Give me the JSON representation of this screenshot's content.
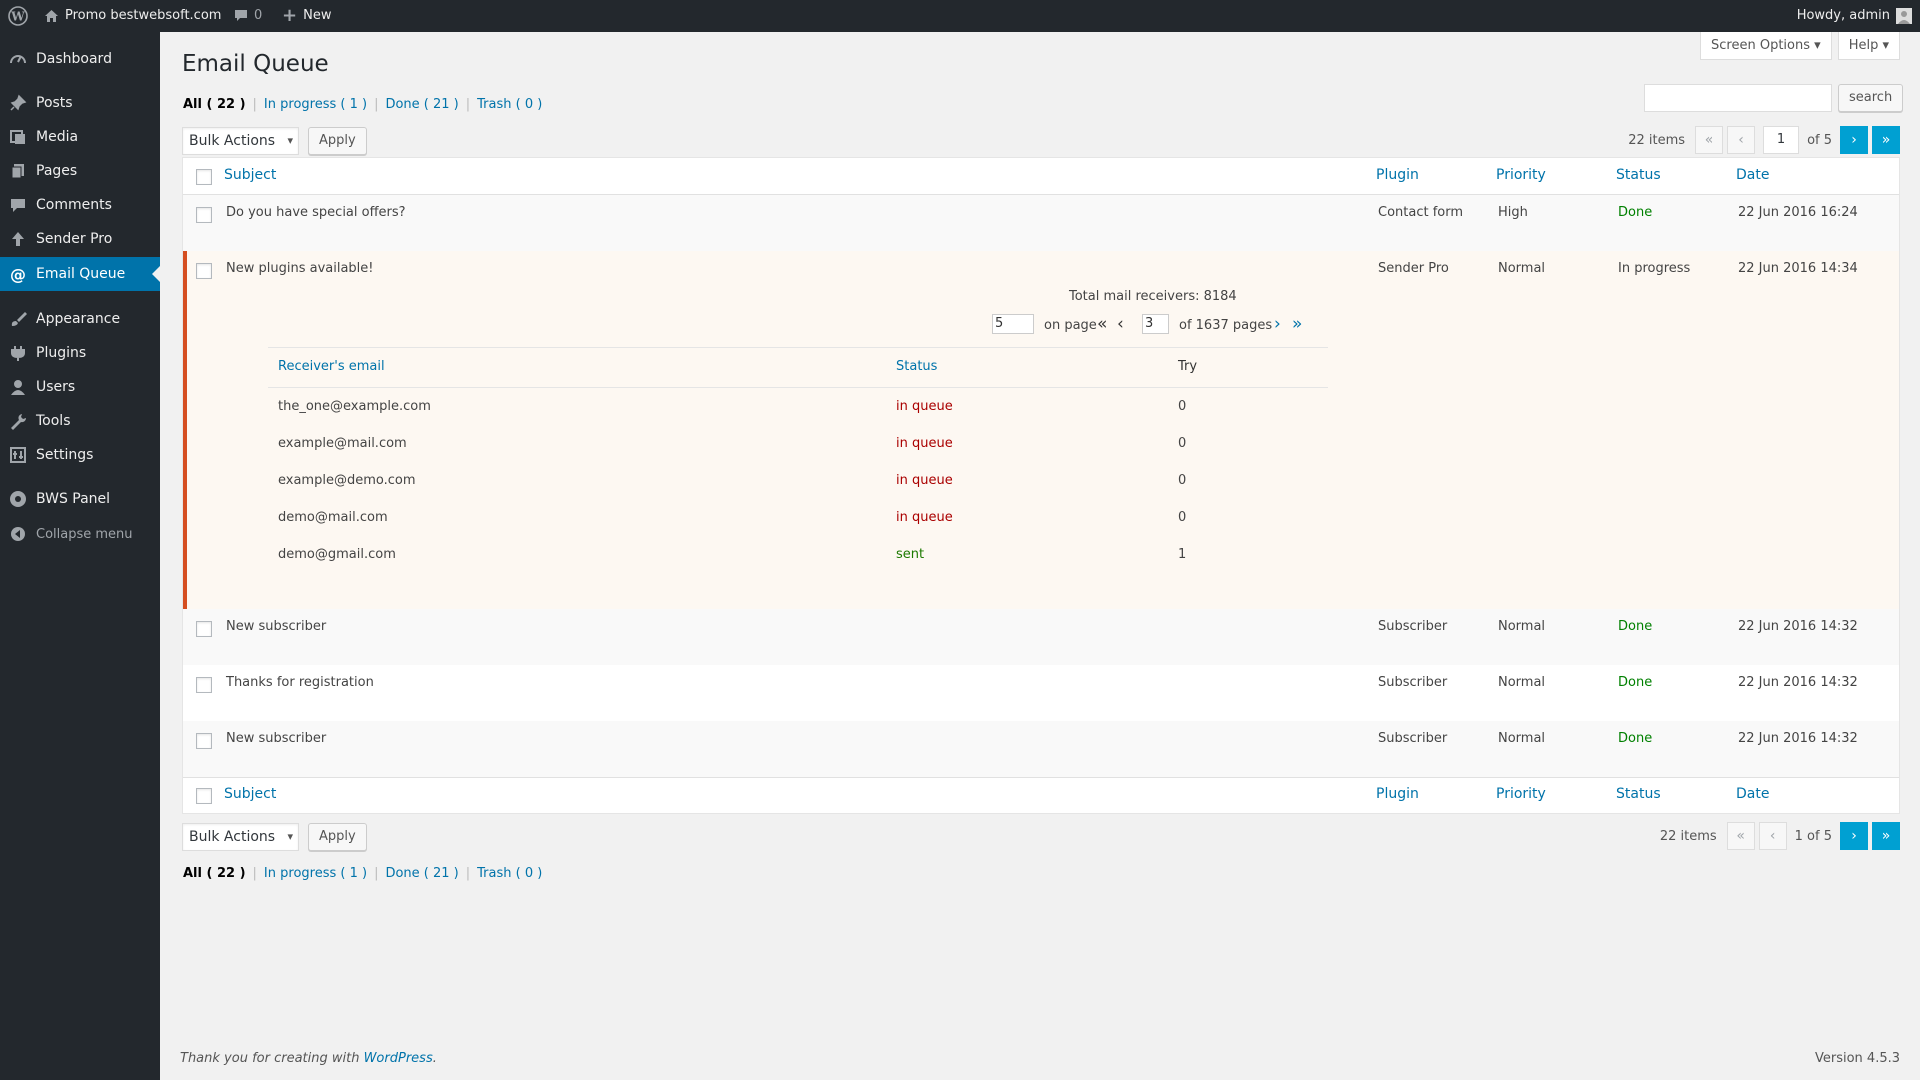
{
  "admin_bar": {
    "site_name": "Promo bestwebsoft.com",
    "comments_count": "0",
    "new_label": "New",
    "howdy": "Howdy, admin"
  },
  "sidebar": {
    "items": [
      {
        "label": "Dashboard",
        "icon": "dashboard-icon"
      },
      {
        "label": "Posts",
        "icon": "pin-icon"
      },
      {
        "label": "Media",
        "icon": "media-icon"
      },
      {
        "label": "Pages",
        "icon": "pages-icon"
      },
      {
        "label": "Comments",
        "icon": "comment-icon"
      },
      {
        "label": "Sender Pro",
        "icon": "upload-icon"
      },
      {
        "label": "Email Queue",
        "icon": "at-icon"
      },
      {
        "label": "Appearance",
        "icon": "brush-icon"
      },
      {
        "label": "Plugins",
        "icon": "plugin-icon"
      },
      {
        "label": "Users",
        "icon": "user-icon"
      },
      {
        "label": "Tools",
        "icon": "wrench-icon"
      },
      {
        "label": "Settings",
        "icon": "settings-icon"
      },
      {
        "label": "BWS Panel",
        "icon": "bws-icon"
      },
      {
        "label": "Collapse menu",
        "icon": "collapse-icon"
      }
    ]
  },
  "header": {
    "screen_options": "Screen Options",
    "help": "Help",
    "title": "Email Queue",
    "search_button": "search"
  },
  "filters": {
    "all": "All ( 22 )",
    "in_progress": "In progress ( 1 )",
    "done": "Done ( 21 )",
    "trash": "Trash ( 0 )"
  },
  "bulk": {
    "select_value": "Bulk Actions",
    "apply": "Apply"
  },
  "pagination_top": {
    "items": "22 items",
    "current_page": "1",
    "of": "of 5"
  },
  "pagination_bottom": {
    "items": "22 items",
    "status": "1 of 5"
  },
  "columns": {
    "subject": "Subject",
    "plugin": "Plugin",
    "priority": "Priority",
    "status": "Status",
    "date": "Date"
  },
  "rows": [
    {
      "subject": "Do you have special offers?",
      "plugin": "Contact form",
      "priority": "High",
      "status": "Done",
      "date": "22 Jun 2016 16:24"
    },
    {
      "subject": "New plugins available!",
      "plugin": "Sender Pro",
      "priority": "Normal",
      "status": "In progress",
      "date": "22 Jun 2016 14:34"
    },
    {
      "subject": "New subscriber",
      "plugin": "Subscriber",
      "priority": "Normal",
      "status": "Done",
      "date": "22 Jun 2016 14:32"
    },
    {
      "subject": "Thanks for registration",
      "plugin": "Subscriber",
      "priority": "Normal",
      "status": "Done",
      "date": "22 Jun 2016 14:32"
    },
    {
      "subject": "New subscriber",
      "plugin": "Subscriber",
      "priority": "Normal",
      "status": "Done",
      "date": "22 Jun 2016 14:32"
    }
  ],
  "receivers": {
    "total": "Total mail receivers: 8184",
    "per_page": "5",
    "on_page": "on page",
    "current_page": "3",
    "of_pages": "of 1637 pages",
    "col_email": "Receiver's email",
    "col_status": "Status",
    "col_try": "Try",
    "list": [
      {
        "email": "the_one@example.com",
        "status": "in queue",
        "try": "0"
      },
      {
        "email": "example@mail.com",
        "status": "in queue",
        "try": "0"
      },
      {
        "email": "example@demo.com",
        "status": "in queue",
        "try": "0"
      },
      {
        "email": "demo@mail.com",
        "status": "in queue",
        "try": "0"
      },
      {
        "email": "demo@gmail.com",
        "status": "sent",
        "try": "1"
      }
    ]
  },
  "footer": {
    "thanks": "Thank you for creating with ",
    "wordpress": "WordPress",
    "period": ".",
    "version": "Version 4.5.3"
  },
  "colors": {
    "admin_bg": "#23282d",
    "accent": "#0073aa",
    "done": "#008000",
    "in_queue": "#aa0000",
    "expanded_border": "#d54e21"
  }
}
